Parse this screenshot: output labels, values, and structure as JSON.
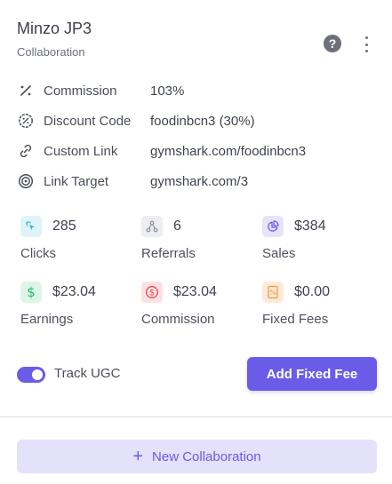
{
  "header": {
    "title": "Minzo JP3",
    "subtitle": "Collaboration"
  },
  "details": [
    {
      "icon": "percent-icon",
      "label": "Commission",
      "value": "103%"
    },
    {
      "icon": "discount-tag-icon",
      "label": "Discount Code",
      "value": "foodinbcn3 (30%)"
    },
    {
      "icon": "link-icon",
      "label": "Custom Link",
      "value": "gymshark.com/foodinbcn3"
    },
    {
      "icon": "target-icon",
      "label": "Link Target",
      "value": "gymshark.com/3"
    }
  ],
  "stats": [
    {
      "icon": "click-icon",
      "value": "285",
      "label": "Clicks",
      "color": "#1fb8d6",
      "bg": "#dff3f9"
    },
    {
      "icon": "share-network-icon",
      "value": "6",
      "label": "Referrals",
      "color": "#8c8f98",
      "bg": "#eceef1"
    },
    {
      "icon": "pie-chart-icon",
      "value": "$384",
      "label": "Sales",
      "color": "#6a5ce6",
      "bg": "#e6e3fb"
    },
    {
      "icon": "dollar-icon",
      "value": "$23.04",
      "label": "Earnings",
      "color": "#22b86a",
      "bg": "#dff5e8"
    },
    {
      "icon": "dollar-circle-icon",
      "value": "$23.04",
      "label": "Commission",
      "color": "#e5484d",
      "bg": "#fbe1e1"
    },
    {
      "icon": "fee-receipt-icon",
      "value": "$0.00",
      "label": "Fixed Fees",
      "color": "#f0993e",
      "bg": "#fdebd9"
    }
  ],
  "toggle": {
    "label": "Track UGC",
    "on": true
  },
  "buttons": {
    "add_fixed_fee": "Add Fixed Fee",
    "new_collaboration": "New Collaboration"
  },
  "colors": {
    "accent": "#6a5ce6",
    "accent_light": "#e4e1fb"
  }
}
